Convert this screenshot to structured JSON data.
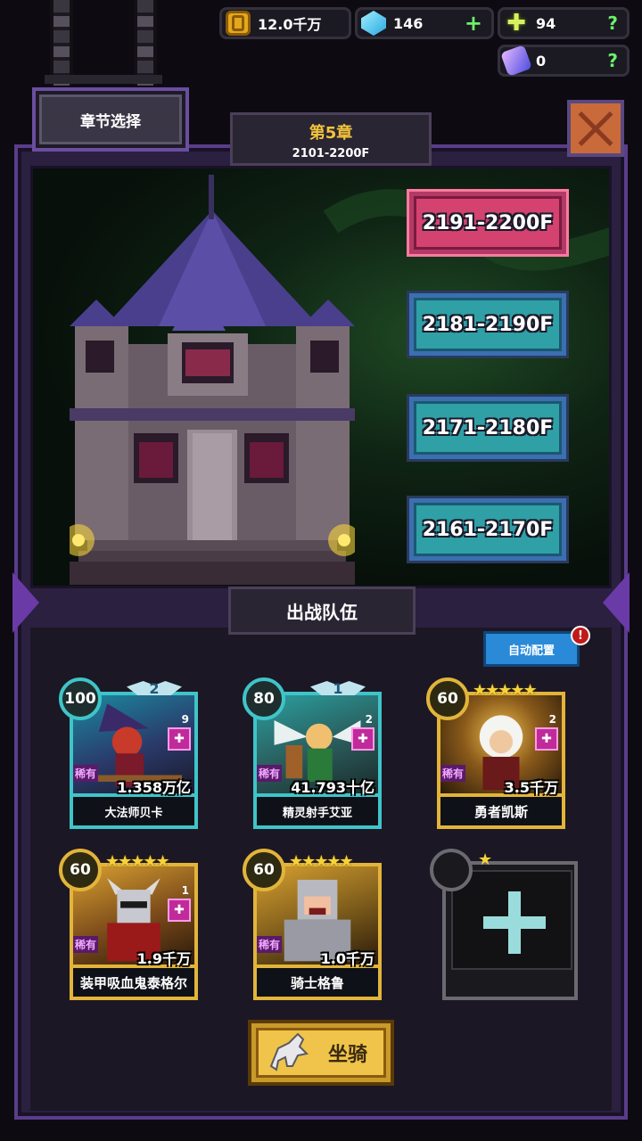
{
  "currency": {
    "gold": "12.0千万",
    "gems": "146",
    "crosses": "94",
    "scrolls": "0",
    "plus": "+",
    "help": "?"
  },
  "chapter": {
    "select_label": "章节选择",
    "title": "第5章",
    "range": "2101-2200F"
  },
  "floors": [
    {
      "label": "2191-2200F",
      "state": "active"
    },
    {
      "label": "2181-2190F",
      "state": "normal"
    },
    {
      "label": "2171-2180F",
      "state": "normal"
    },
    {
      "label": "2161-2170F",
      "state": "normal"
    }
  ],
  "team": {
    "title": "出战队伍",
    "auto_label": "自动配置",
    "auto_badge": "!",
    "heroes": [
      {
        "level": "100",
        "awaken": "2",
        "stars": 0,
        "rarity": "稀有",
        "power": "1.358万亿",
        "name": "大法师贝卡",
        "count": "9",
        "frame": "teal"
      },
      {
        "level": "80",
        "awaken": "1",
        "stars": 0,
        "rarity": "稀有",
        "power": "41.793十亿",
        "name": "精灵射手艾亚",
        "count": "2",
        "frame": "teal"
      },
      {
        "level": "60",
        "awaken": "",
        "stars": 5,
        "rarity": "稀有",
        "power": "3.5千万",
        "name": "勇者凯斯",
        "count": "2",
        "frame": "gold"
      },
      {
        "level": "60",
        "awaken": "",
        "stars": 5,
        "rarity": "稀有",
        "power": "1.9千万",
        "name": "装甲吸血鬼泰格尔",
        "count": "1",
        "frame": "gold"
      },
      {
        "level": "60",
        "awaken": "",
        "stars": 5,
        "rarity": "稀有",
        "power": "1.0千万",
        "name": "骑士格鲁",
        "count": "",
        "frame": "gold"
      }
    ],
    "empty_slot_stars": 1
  },
  "mount": {
    "label": "坐骑"
  },
  "colors": {
    "active_floor": "#d4426f",
    "normal_floor": "#2fa0a6",
    "frame_purple": "#5a3d8a",
    "gold_frame": "#e2b43a",
    "teal_frame": "#3fc4c9"
  }
}
